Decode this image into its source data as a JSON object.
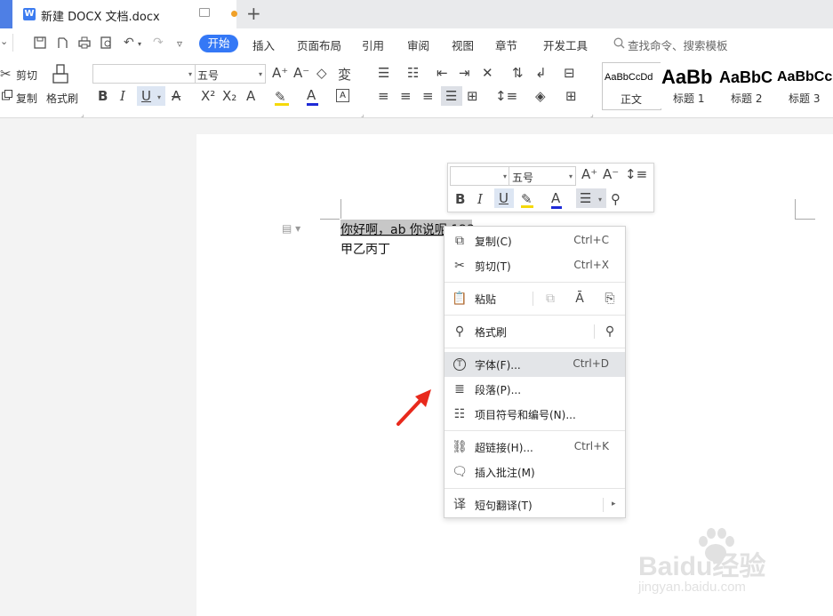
{
  "tab": {
    "title": "新建 DOCX 文档.docx",
    "logo": "W"
  },
  "menu": {
    "items": [
      "开始",
      "插入",
      "页面布局",
      "引用",
      "审阅",
      "视图",
      "章节",
      "开发工具"
    ],
    "search_placeholder": "查找命令、搜索模板"
  },
  "ribbon": {
    "cut_label": "剪切",
    "copy_label": "复制",
    "format_painter_label": "格式刷",
    "font_name": "",
    "font_size": "五号",
    "styles": [
      {
        "sample": "AaBbCcDd",
        "name": "正文"
      },
      {
        "sample": "AaBb",
        "name": "标题 1"
      },
      {
        "sample": "AaBbC",
        "name": "标题 2"
      },
      {
        "sample": "AaBbCc",
        "name": "标题 3"
      }
    ]
  },
  "document": {
    "line1": "你好啊，ab 你说呢 123",
    "line2": "甲乙丙丁"
  },
  "float_toolbar": {
    "font_name": "",
    "font_size": "五号"
  },
  "context_menu": {
    "items": [
      {
        "label": "复制(C)",
        "shortcut": "Ctrl+C",
        "icon": "copy-icon"
      },
      {
        "label": "剪切(T)",
        "shortcut": "Ctrl+X",
        "icon": "scissors-icon"
      },
      {
        "label": "粘贴",
        "shortcut": "",
        "icon": "paste-icon"
      },
      {
        "label": "格式刷",
        "shortcut": "",
        "icon": "brush-icon"
      },
      {
        "label": "字体(F)...",
        "shortcut": "Ctrl+D",
        "icon": "font-icon"
      },
      {
        "label": "段落(P)...",
        "shortcut": "",
        "icon": "paragraph-icon"
      },
      {
        "label": "项目符号和编号(N)...",
        "shortcut": "",
        "icon": "list-icon"
      },
      {
        "label": "超链接(H)...",
        "shortcut": "Ctrl+K",
        "icon": "link-icon"
      },
      {
        "label": "插入批注(M)",
        "shortcut": "",
        "icon": "comment-icon"
      },
      {
        "label": "短句翻译(T)",
        "shortcut": "",
        "icon": "translate-icon"
      }
    ]
  },
  "watermark": {
    "brand": "Baidu经验",
    "url": "jingyan.baidu.com"
  },
  "colors": {
    "accent": "#3478f6",
    "arrow": "#e8291c",
    "highlight": "#f5d90a",
    "font_color": "#1f2bd6"
  }
}
